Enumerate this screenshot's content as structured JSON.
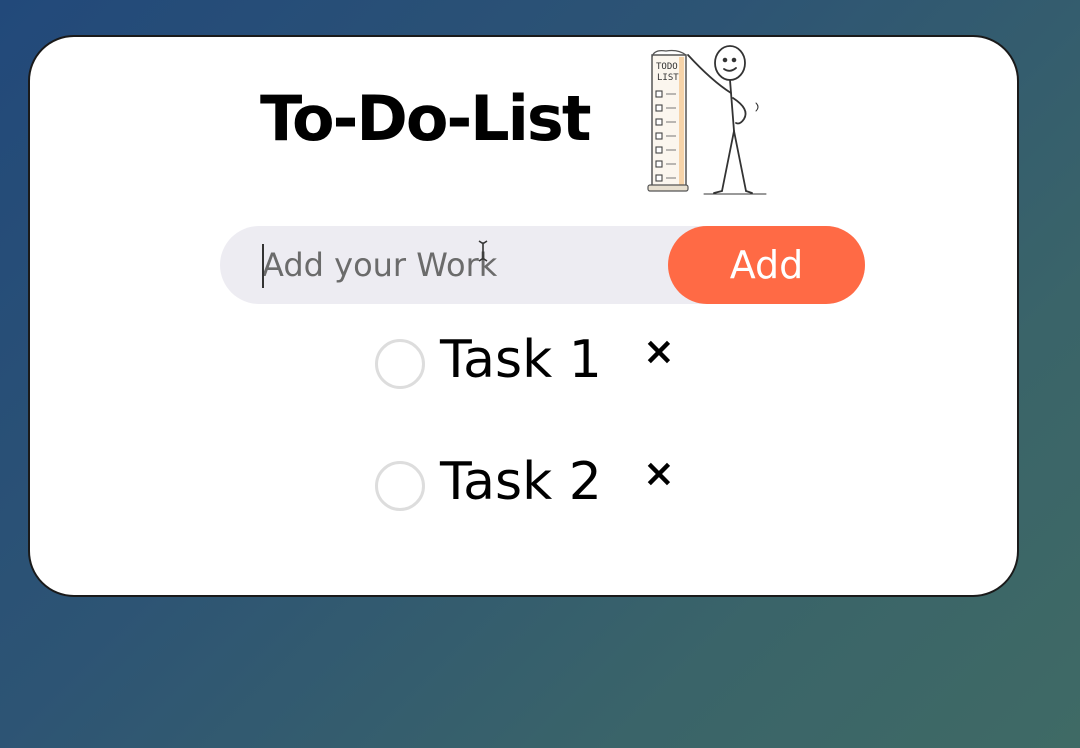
{
  "app": {
    "title": "To-Do-List"
  },
  "illustration": {
    "icon": "stick-figure-todo-list-icon",
    "sign_text": "TODO LIST"
  },
  "input": {
    "placeholder": "Add your Work",
    "value": ""
  },
  "add_button": {
    "label": "Add"
  },
  "tasks": [
    {
      "label": "Task 1",
      "checked": false,
      "remove_icon": "×"
    },
    {
      "label": "Task 2",
      "checked": false,
      "remove_icon": "×"
    }
  ],
  "colors": {
    "accent": "#ff6a45",
    "input_bg": "#edecf2",
    "card_bg": "#ffffff",
    "check_border": "#dddddd",
    "page_gradient_start": "#22497a",
    "page_gradient_end": "#3f6a65"
  }
}
